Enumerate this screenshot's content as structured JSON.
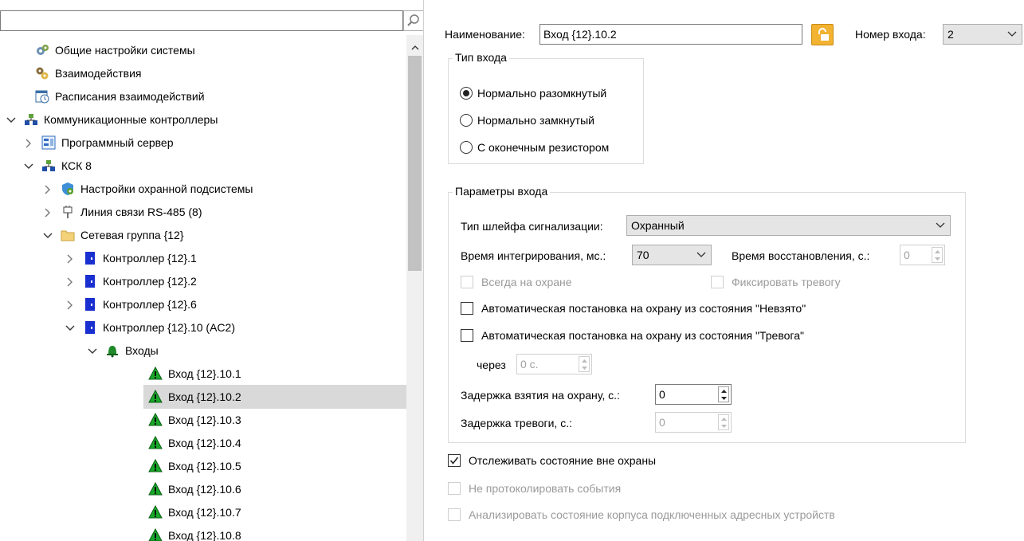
{
  "tree": {
    "search_value": "",
    "items": [
      {
        "label": "Общие настройки системы",
        "icon": "gears-icon",
        "expander": "none"
      },
      {
        "label": "Взаимодействия",
        "icon": "interaction-icon",
        "expander": "none"
      },
      {
        "label": "Расписания взаимодействий",
        "icon": "schedule-icon",
        "expander": "none"
      },
      {
        "label": "Коммуникационные контроллеры",
        "icon": "network-controllers-icon",
        "expander": "expanded"
      },
      {
        "label": "Программный сервер",
        "icon": "server-icon",
        "expander": "collapsed"
      },
      {
        "label": "КСК 8",
        "icon": "network-controllers-icon",
        "expander": "expanded"
      },
      {
        "label": "Настройки охранной подсистемы",
        "icon": "shield-settings-icon",
        "expander": "collapsed"
      },
      {
        "label": "Линия связи RS-485 (8)",
        "icon": "plug-icon",
        "expander": "collapsed"
      },
      {
        "label": "Сетевая группа {12}",
        "icon": "folder-icon",
        "expander": "expanded"
      },
      {
        "label": "Контроллер {12}.1",
        "icon": "controller-icon",
        "expander": "collapsed"
      },
      {
        "label": "Контроллер {12}.2",
        "icon": "controller-icon",
        "expander": "collapsed"
      },
      {
        "label": "Контроллер {12}.6",
        "icon": "controller-icon",
        "expander": "collapsed"
      },
      {
        "label": "Контроллер {12}.10 (AC2)",
        "icon": "controller-icon",
        "expander": "expanded"
      },
      {
        "label": "Входы",
        "icon": "bell-icon",
        "expander": "expanded"
      },
      {
        "label": "Вход {12}.10.1",
        "icon": "input-warning-icon",
        "expander": "none"
      },
      {
        "label": "Вход {12}.10.2",
        "icon": "input-warning-icon",
        "expander": "none",
        "selected": true
      },
      {
        "label": "Вход {12}.10.3",
        "icon": "input-warning-icon",
        "expander": "none"
      },
      {
        "label": "Вход {12}.10.4",
        "icon": "input-warning-icon",
        "expander": "none"
      },
      {
        "label": "Вход {12}.10.5",
        "icon": "input-warning-icon",
        "expander": "none"
      },
      {
        "label": "Вход {12}.10.6",
        "icon": "input-warning-icon",
        "expander": "none"
      },
      {
        "label": "Вход {12}.10.7",
        "icon": "input-warning-icon",
        "expander": "none"
      },
      {
        "label": "Вход {12}.10.8",
        "icon": "input-warning-icon",
        "expander": "none"
      }
    ]
  },
  "props": {
    "name_label": "Наименование:",
    "name_value": "Вход {12}.10.2",
    "input_number_label": "Номер входа:",
    "input_number_value": "2",
    "input_type": {
      "title": "Тип входа",
      "options": [
        {
          "label": "Нормально разомкнутый",
          "checked": true
        },
        {
          "label": "Нормально замкнутый",
          "checked": false
        },
        {
          "label": "С оконечным резистором",
          "checked": false
        }
      ]
    },
    "params": {
      "title": "Параметры входа",
      "loop_type_label": "Тип шлейфа сигнализации:",
      "loop_type_value": "Охранный",
      "integration_label": "Время интегрирования, мс.:",
      "integration_value": "70",
      "restore_label": "Время восстановления, с.:",
      "restore_value": "0",
      "always_armed_label": "Всегда на охране",
      "fix_alarm_label": "Фиксировать тревогу",
      "auto_arm_unarmed_label": "Автоматическая постановка на охрану из состояния \"Невзято\"",
      "auto_arm_alarm_label": "Автоматическая постановка на охрану из состояния \"Тревога\"",
      "after_label": "через",
      "after_value": "0 с.",
      "arm_delay_label": "Задержка взятия на охрану, с.:",
      "arm_delay_value": "0",
      "alarm_delay_label": "Задержка тревоги, с.:",
      "alarm_delay_value": "0"
    },
    "track_state_label": "Отслеживать состояние вне охраны",
    "track_state_checked": true,
    "no_log_label": "Не протоколировать события",
    "analyze_label": "Анализировать состояние корпуса подключенных адресных устройств"
  }
}
